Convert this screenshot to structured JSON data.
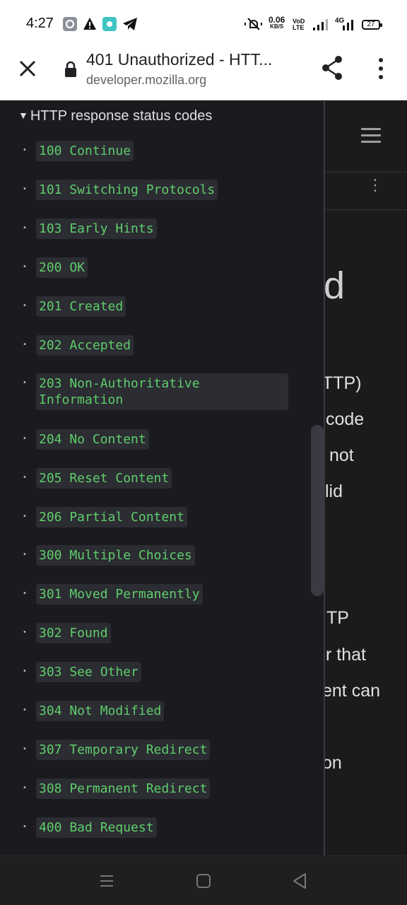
{
  "status_bar": {
    "time": "4:27",
    "net_speed_value": "0.06",
    "net_speed_unit": "KB/S",
    "volte_top": "VoD",
    "volte_bottom": "LTE",
    "signal_label": "4G",
    "battery": "27",
    "icons": [
      "settings-app-icon",
      "warning-icon",
      "app-icon",
      "telegram-icon",
      "mute-icon",
      "signal-icon",
      "battery-icon"
    ]
  },
  "browser": {
    "title": "401 Unauthorized - HTT...",
    "host": "developer.mozilla.org",
    "icons": [
      "close-icon",
      "lock-icon",
      "share-icon",
      "more-vert-icon"
    ]
  },
  "sidebar": {
    "heading": "HTTP response status codes",
    "items": [
      {
        "label": "100 Continue"
      },
      {
        "label": "101 Switching Protocols"
      },
      {
        "label": "103 Early Hints"
      },
      {
        "label": "200 OK"
      },
      {
        "label": "201 Created"
      },
      {
        "label": "202 Accepted"
      },
      {
        "label": "203 Non-Authoritative Information"
      },
      {
        "label": "204 No Content"
      },
      {
        "label": "205 Reset Content"
      },
      {
        "label": "206 Partial Content"
      },
      {
        "label": "300 Multiple Choices"
      },
      {
        "label": "301 Moved Permanently"
      },
      {
        "label": "302 Found"
      },
      {
        "label": "303 See Other"
      },
      {
        "label": "304 Not Modified"
      },
      {
        "label": "307 Temporary Redirect"
      },
      {
        "label": "308 Permanent Redirect"
      },
      {
        "label": "400 Bad Request"
      }
    ]
  },
  "page_fragments": {
    "heading_tail": "d",
    "line1": "TTP)",
    "line2": "code",
    "line3": "not",
    "line4": "lid",
    "line5": "TP",
    "line6": "r that",
    "line7": "ent can",
    "line8": "on"
  },
  "nav_bar": {
    "icons": [
      "recent-apps-icon",
      "home-icon",
      "back-icon"
    ]
  },
  "colors": {
    "code_text": "#5ece6a",
    "chip_bg": "#2c2c33",
    "sidebar_bg": "#1a1a1f",
    "page_bg": "#1b1b1b"
  }
}
